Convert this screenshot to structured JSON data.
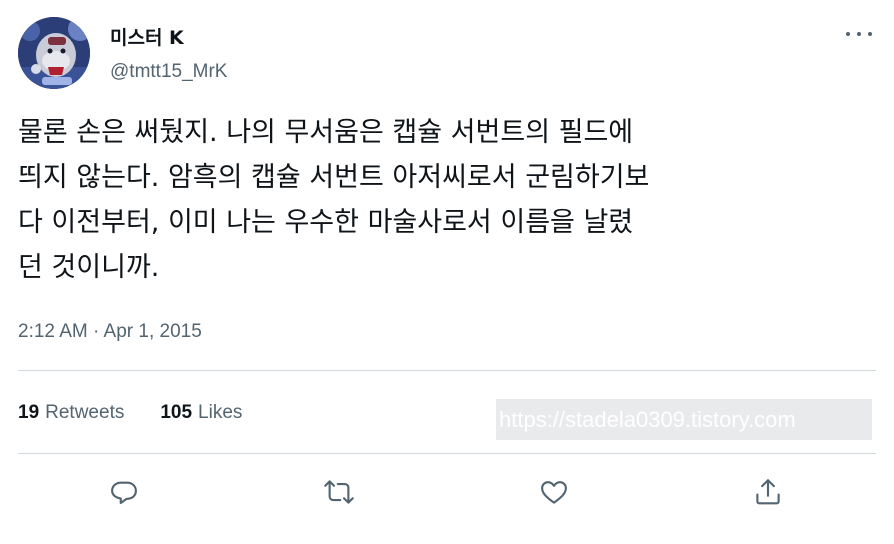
{
  "user": {
    "display_name": "미스터 K",
    "handle": "@tmtt15_MrK"
  },
  "tweet": {
    "text": "물론 손은 써뒀지. 나의 무서움은 캡슐 서번트의 필드에\n띄지 않는다. 암흑의 캡슐 서번트 아저씨로서 군림하기보\n다 이전부터, 이미 나는 우수한 마술사로서 이름을 날렸\n던 것이니까.",
    "timestamp": "2:12 AM · Apr 1, 2015"
  },
  "stats": {
    "retweets_count": "19",
    "retweets_label": "Retweets",
    "likes_count": "105",
    "likes_label": "Likes"
  },
  "watermark": {
    "text": "https://stadela0309.tistory.com"
  },
  "icons": {
    "more": "more-options-icon",
    "reply": "reply-icon",
    "retweet": "retweet-icon",
    "like": "like-icon",
    "share": "share-icon"
  },
  "colors": {
    "text_primary": "#0f1419",
    "text_secondary": "#536471",
    "divider": "#cfd9de"
  }
}
